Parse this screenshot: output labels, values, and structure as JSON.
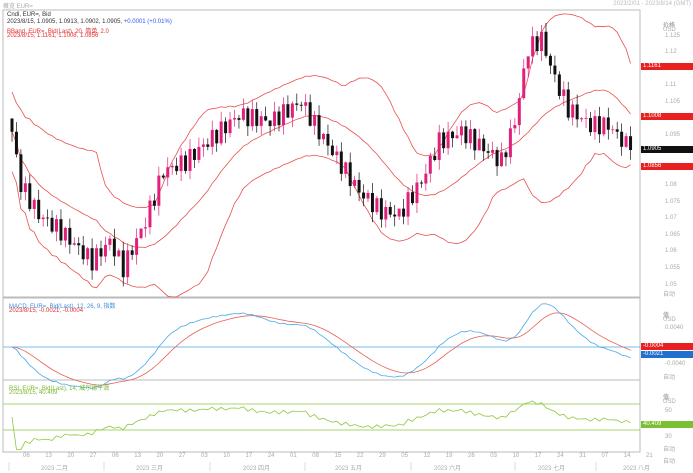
{
  "header": {
    "title": "概览 EUR=",
    "range": "2023/2/01 - 2023/8/14 (GMT)"
  },
  "legend": {
    "candle_title": "Cndl, EUR=, Bid",
    "candle_values": "2023/8/15, 1.0905, 1.0913, 1.0902, 1.0905,",
    "candle_change": "+0.0001 (+0.01%)",
    "bband_title": "BBand, EUR=, Bid(Last), 20, 简单, 2.0",
    "bband_values": "2023/8/15, 1.1161, 1.1008, 1.0856",
    "macd_title": "MACD, EUR=, Bid(Last), 12, 26, 9, 指数",
    "macd_values": "2023/8/15, -0.0021, -0.0004",
    "rsi_title": "RSI, EUR=, Bid(Last), 14, 威尔德平滑",
    "rsi_values": "2023/8/15, 40.409"
  },
  "price_axis": {
    "title": "价格",
    "unit": "USD",
    "ticks": [
      "1.125",
      "1.12",
      "1.11",
      "1.105",
      "1.095",
      "1.08",
      "1.075",
      "1.07",
      "1.065",
      "1.06",
      "1.055",
      "1.05"
    ],
    "tag_upper": "1.1161",
    "tag_mid": "1.1008",
    "tag_last": "1.0905",
    "tag_lower": "1.0856",
    "footer": "自动"
  },
  "macd_axis": {
    "title": "值",
    "unit": "USD",
    "ticks": [
      "0.0040",
      "-0.0040"
    ],
    "tag_signal": "-0.0004",
    "tag_macd": "-0.0021",
    "footer": "自动"
  },
  "rsi_axis": {
    "title": "值",
    "unit": "USD",
    "ticks": [
      "50",
      "30"
    ],
    "tag_rsi": "40.409",
    "footer": "自动"
  },
  "date_axis": {
    "days": [
      "06",
      "13",
      "20",
      "27",
      "06",
      "13",
      "20",
      "27",
      "03",
      "10",
      "17",
      "24",
      "01",
      "08",
      "15",
      "22",
      "29",
      "05",
      "12",
      "19",
      "26",
      "03",
      "10",
      "17",
      "24",
      "31",
      "07",
      "14",
      "21"
    ],
    "months": [
      "2023 二月",
      "2023 三月",
      "2023 四月",
      "2023 五月",
      "2023 六月",
      "2023 七月",
      "2023 八月"
    ],
    "footer": "自动"
  },
  "colors": {
    "up": "#e0207a",
    "down": "#111111",
    "band": "#e85050",
    "macd": "#4aa8e8",
    "signal": "#e86050",
    "rsi": "#8cc83c",
    "rsi_levels": "#8cc83c"
  },
  "chart_data": {
    "type": "candlestick",
    "indicators": [
      "BBand 20 2.0",
      "MACD 12 26 9",
      "RSI 14"
    ],
    "ylim": [
      1.0462,
      1.1327
    ],
    "rsi_levels": [
      70,
      30
    ],
    "close_anchors": [
      [
        "2023-02-01",
        1.096
      ],
      [
        "2023-02-03",
        1.08
      ],
      [
        "2023-02-09",
        1.071
      ],
      [
        "2023-02-16",
        1.066
      ],
      [
        "2023-02-27",
        1.057
      ],
      [
        "2023-03-03",
        1.063
      ],
      [
        "2023-03-08",
        1.055
      ],
      [
        "2023-03-15",
        1.069
      ],
      [
        "2023-03-21",
        1.084
      ],
      [
        "2023-03-28",
        1.087
      ],
      [
        "2023-04-04",
        1.093
      ],
      [
        "2023-04-13",
        1.101
      ],
      [
        "2023-04-24",
        1.099
      ],
      [
        "2023-05-03",
        1.105
      ],
      [
        "2023-05-09",
        1.096
      ],
      [
        "2023-05-16",
        1.086
      ],
      [
        "2023-05-22",
        1.078
      ],
      [
        "2023-05-29",
        1.072
      ],
      [
        "2023-06-02",
        1.071
      ],
      [
        "2023-06-09",
        1.081
      ],
      [
        "2023-06-15",
        1.093
      ],
      [
        "2023-06-22",
        1.096
      ],
      [
        "2023-06-28",
        1.092
      ],
      [
        "2023-07-05",
        1.087
      ],
      [
        "2023-07-10",
        1.099
      ],
      [
        "2023-07-13",
        1.121
      ],
      [
        "2023-07-18",
        1.124
      ],
      [
        "2023-07-21",
        1.112
      ],
      [
        "2023-07-26",
        1.103
      ],
      [
        "2023-08-02",
        1.098
      ],
      [
        "2023-08-08",
        1.098
      ],
      [
        "2023-08-14",
        1.092
      ],
      [
        "2023-08-15",
        1.0905
      ]
    ]
  }
}
